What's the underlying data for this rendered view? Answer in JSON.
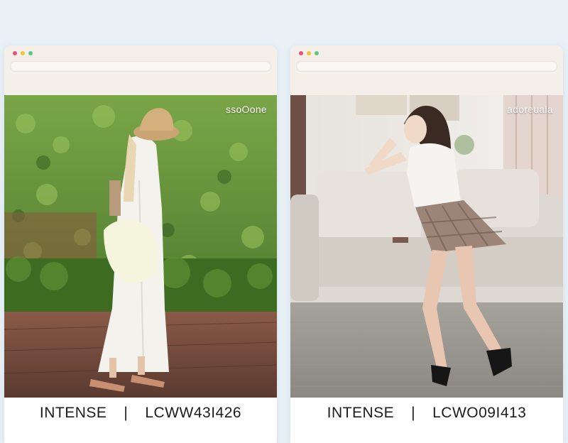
{
  "cards": [
    {
      "handle": "ssoOone",
      "brand": "INTENSE",
      "separator": "|",
      "code": "LCWW43I426"
    },
    {
      "handle": "adoreuala",
      "brand": "INTENSE",
      "separator": "|",
      "code": "LCWO09I413"
    }
  ],
  "colors": {
    "page_background": "#e9f1f7",
    "chrome": "#f4efe9",
    "dot_red": "#e5507e",
    "dot_yellow": "#f1c23a",
    "dot_green": "#5dc77f"
  }
}
